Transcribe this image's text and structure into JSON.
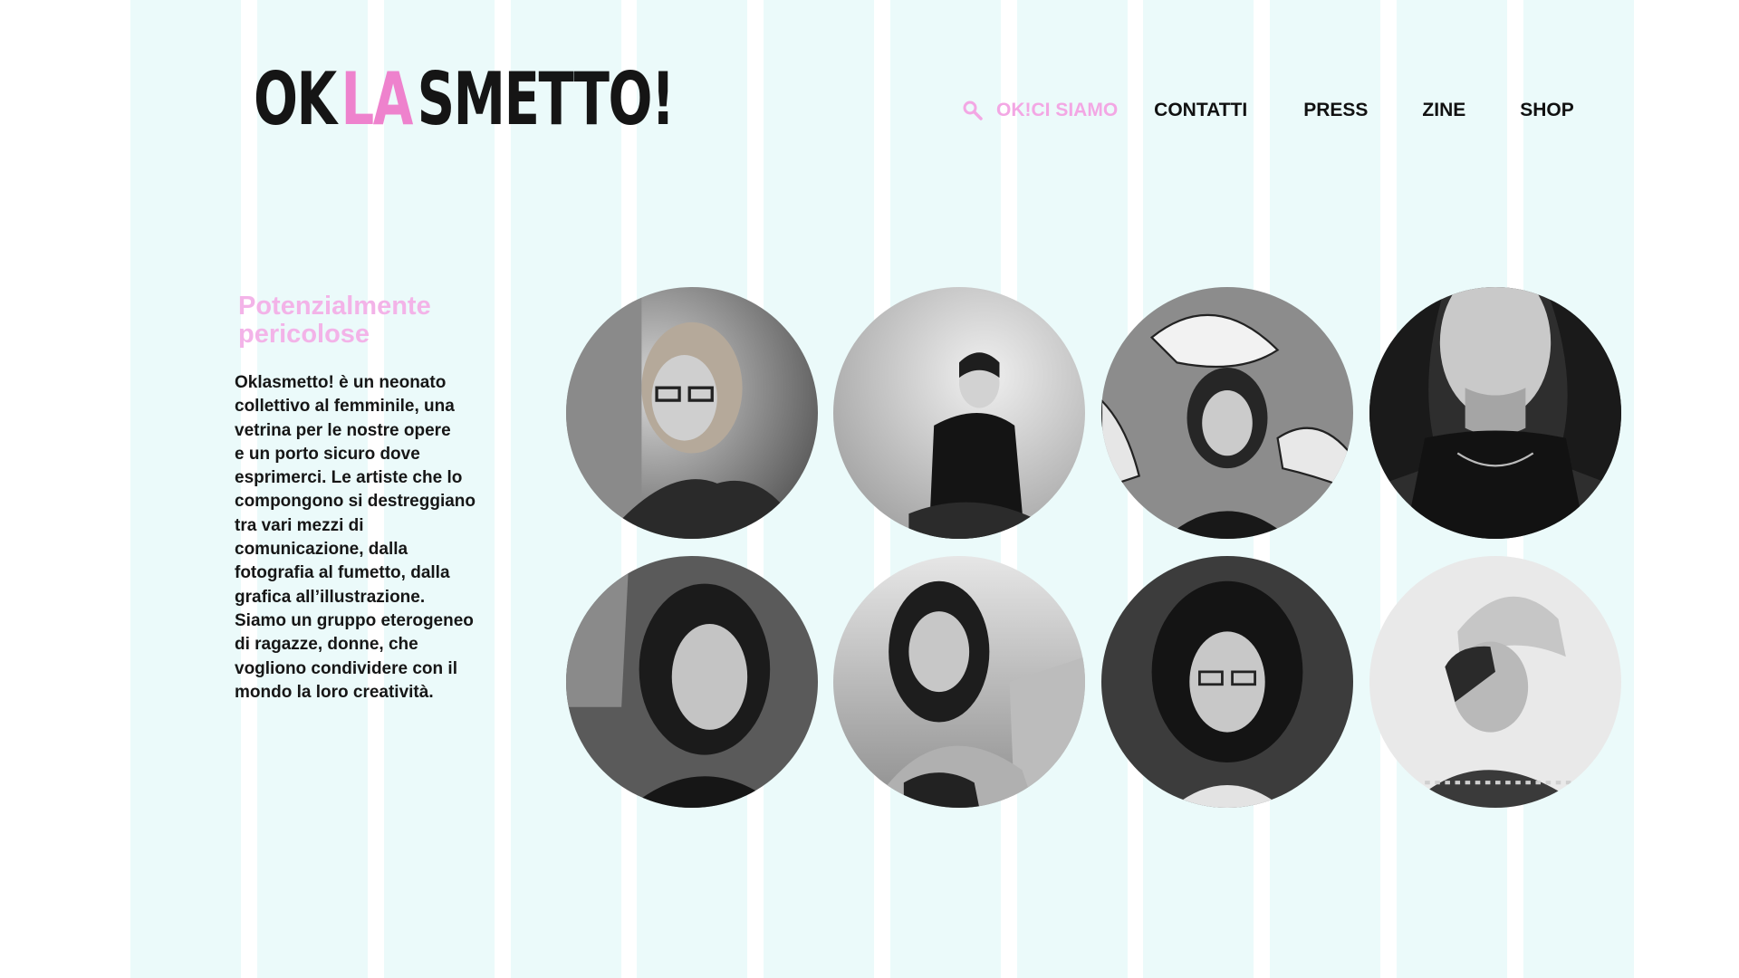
{
  "logo": {
    "ok": "OK",
    "la": "LA",
    "smetto": "SMETTO!"
  },
  "nav": {
    "search_icon": "search-icon",
    "items": [
      {
        "label": "OK!CI SIAMO",
        "active": true
      },
      {
        "label": "CONTATTI",
        "active": false
      },
      {
        "label": "PRESS",
        "active": false
      },
      {
        "label": "ZINE",
        "active": false
      },
      {
        "label": "SHOP",
        "active": false
      }
    ]
  },
  "intro": {
    "heading_line1": "Potenzialmente",
    "heading_line2": "pericolose",
    "body_lines": [
      "Oklasmetto! è un neonato",
      "collettivo al femminile, una",
      "vetrina per le nostre opere",
      "e un porto sicuro dove",
      "esprimerci. Le artiste che lo",
      "compongono si destreggiano",
      "tra vari mezzi di",
      "comunicazione, dalla",
      "fotografia al fumetto, dalla",
      "grafica all’illustrazione.",
      "Siamo un gruppo eterogeneo",
      "di ragazze, donne, che",
      "vogliono condividere con il",
      "mondo la loro creatività."
    ]
  },
  "colors": {
    "stripe": "#ebfafa",
    "accent_pink": "#f3a7e4",
    "logo_pink": "#ee82cd",
    "text": "#161616"
  },
  "portraits": [
    "portrait-1-blonde-glasses",
    "portrait-2-seated-sweater",
    "portrait-3-illustration-wall",
    "portrait-4-curly-closeup",
    "portrait-5-dark-wavy-hair",
    "portrait-6-outdoor-smile",
    "portrait-7-curly-glasses",
    "portrait-8-beanie-profile"
  ]
}
